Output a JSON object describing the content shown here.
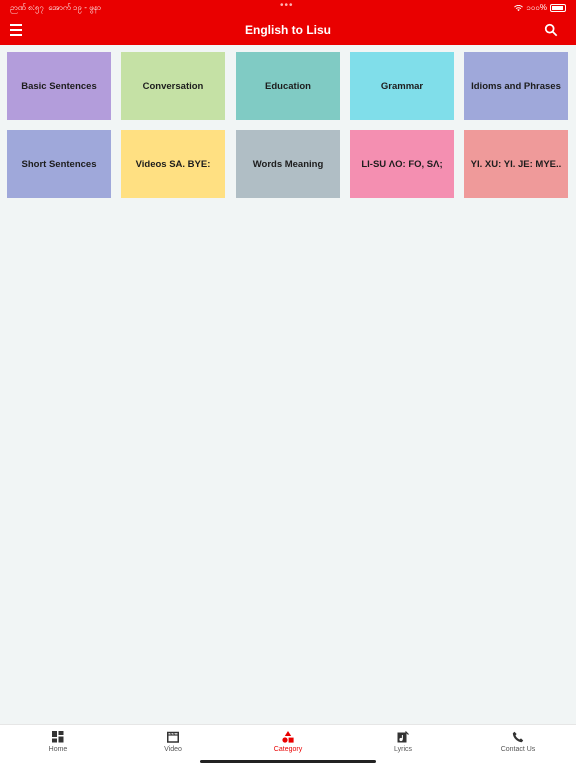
{
  "status": {
    "time": "ဉာဏ် ၈:၅၇",
    "date": "အောက် ၁၉ - ဖွနာ",
    "battery": "၁၀၀%"
  },
  "appbar": {
    "title": "English to Lisu",
    "menu_icon": "hamburger-icon",
    "search_icon": "search-icon"
  },
  "categories": [
    {
      "label": "Basic Sentences",
      "color": "#b39ddb"
    },
    {
      "label": "Conversation",
      "color": "#c5e1a5"
    },
    {
      "label": "Education",
      "color": "#80cbc4"
    },
    {
      "label": "Grammar",
      "color": "#80deea"
    },
    {
      "label": "Idioms and Phrases",
      "color": "#9fa8da"
    },
    {
      "label": "Short Sentences",
      "color": "#9fa8da"
    },
    {
      "label": "Videos SA. BYE:",
      "color": "#ffe082"
    },
    {
      "label": "Words Meaning",
      "color": "#b0bec5"
    },
    {
      "label": "LI-SU ɅO: FO, SɅ;",
      "color": "#f48fb1"
    },
    {
      "label": "YI. XU: YI. JE: MYE..",
      "color": "#ef9a9a"
    }
  ],
  "nav": [
    {
      "label": "Home",
      "icon": "grid-icon"
    },
    {
      "label": "Video",
      "icon": "film-icon"
    },
    {
      "label": "Category",
      "icon": "shapes-icon",
      "active": true
    },
    {
      "label": "Lyrics",
      "icon": "music-icon"
    },
    {
      "label": "Contact Us",
      "icon": "phone-icon"
    }
  ],
  "colors": {
    "accent": "#e90000",
    "background": "#f1f5f5"
  }
}
